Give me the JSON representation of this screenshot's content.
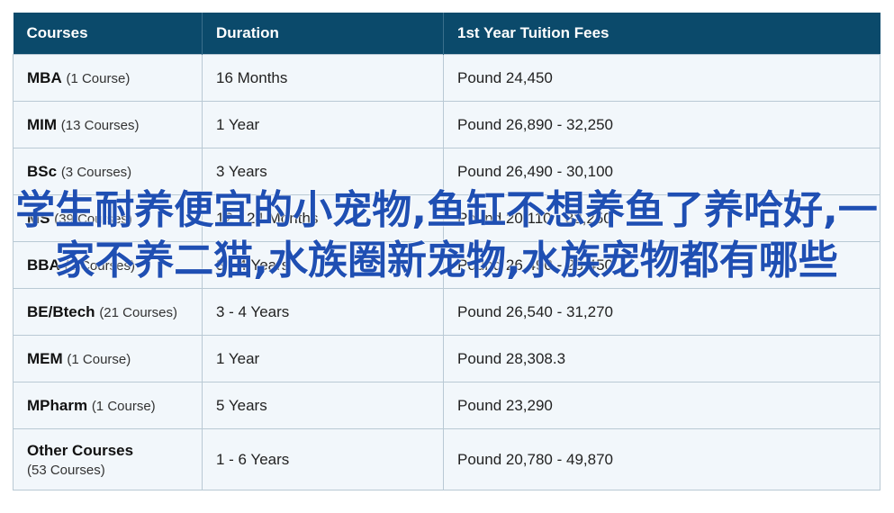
{
  "table": {
    "headers": [
      "Courses",
      "Duration",
      "1st Year Tuition Fees"
    ],
    "rows": [
      {
        "course": "MBA",
        "count": "(1 Course)",
        "duration": "16 Months",
        "fees": "Pound 24,450"
      },
      {
        "course": "MIM",
        "count": "(13 Courses)",
        "duration": "1 Year",
        "fees": "Pound 26,890 - 32,250"
      },
      {
        "course": "BSc",
        "count": "(3 Courses)",
        "duration": "3 Years",
        "fees": "Pound 26,490 - 30,100"
      },
      {
        "course": "MS",
        "count": "(39 Courses)",
        "duration": "12 - 24 Months",
        "fees": "Pound 20,110 - 32,250"
      },
      {
        "course": "BBA",
        "count": "(2 Courses)",
        "duration": "3 - 4 Years",
        "fees": "Pound 26,490 - 28,450"
      },
      {
        "course": "BE/Btech",
        "count": "(21 Courses)",
        "duration": "3 - 4 Years",
        "fees": "Pound 26,540 - 31,270"
      },
      {
        "course": "MEM",
        "count": "(1 Course)",
        "duration": "1 Year",
        "fees": "Pound 28,308.3"
      },
      {
        "course": "MPharm",
        "count": "(1 Course)",
        "duration": "5 Years",
        "fees": "Pound 23,290"
      },
      {
        "course": "Other Courses",
        "count": "(53 Courses)",
        "duration": "1 - 6 Years",
        "fees": "Pound 20,780 - 49,870"
      }
    ]
  },
  "overlay_text": "学生耐养便宜的小宠物,鱼缸不想养鱼了养哈好,一家不养二猫,水族圈新宠物,水族宠物都有哪些"
}
